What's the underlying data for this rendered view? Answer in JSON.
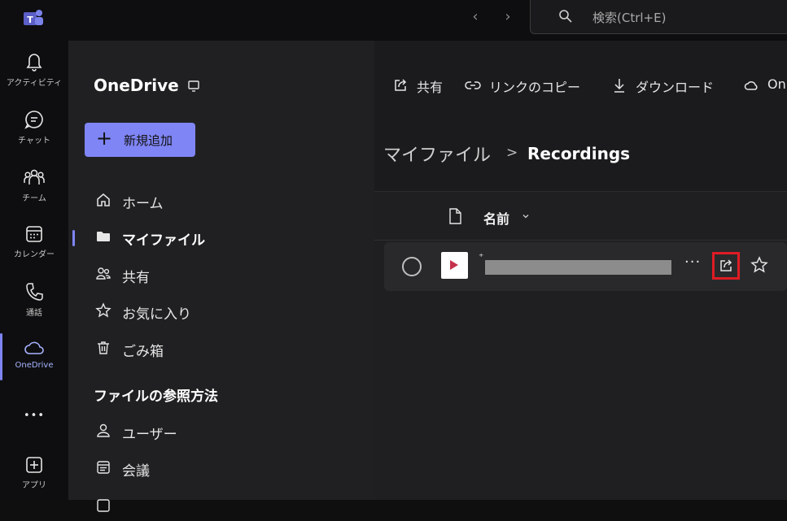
{
  "search": {
    "placeholder": "検索(Ctrl+E)"
  },
  "rail": {
    "items": [
      {
        "label": "アクティビティ",
        "icon": "bell-icon"
      },
      {
        "label": "チャット",
        "icon": "chat-icon"
      },
      {
        "label": "チーム",
        "icon": "teams-icon"
      },
      {
        "label": "カレンダー",
        "icon": "calendar-icon"
      },
      {
        "label": "通話",
        "icon": "phone-icon"
      },
      {
        "label": "OneDrive",
        "icon": "cloud-icon"
      },
      {
        "label": "アプリ",
        "icon": "apps-icon"
      }
    ],
    "more": "•••"
  },
  "sidebar": {
    "title": "OneDrive",
    "new_button": "新規追加",
    "items": [
      {
        "label": "ホーム",
        "icon": "home-icon"
      },
      {
        "label": "マイファイル",
        "icon": "folder-icon"
      },
      {
        "label": "共有",
        "icon": "people-icon"
      },
      {
        "label": "お気に入り",
        "icon": "star-icon"
      },
      {
        "label": "ごみ箱",
        "icon": "trash-icon"
      }
    ],
    "browse_heading": "ファイルの参照方法",
    "browse_items": [
      {
        "label": "ユーザー",
        "icon": "person-icon"
      },
      {
        "label": "会議",
        "icon": "meeting-icon"
      }
    ]
  },
  "toolbar": {
    "share": "共有",
    "copy_link": "リンクのコピー",
    "download": "ダウンロード",
    "onedrive_partial": "On"
  },
  "breadcrumb": {
    "root": "マイファイル",
    "separator": ">",
    "current": "Recordings"
  },
  "file_list": {
    "name_header": "名前",
    "rows": [
      {
        "new_indicator": "⁺",
        "more": "···"
      }
    ]
  },
  "colors": {
    "accent": "#7f85f5",
    "highlight": "#e01b24",
    "video_icon": "#c4314b"
  }
}
